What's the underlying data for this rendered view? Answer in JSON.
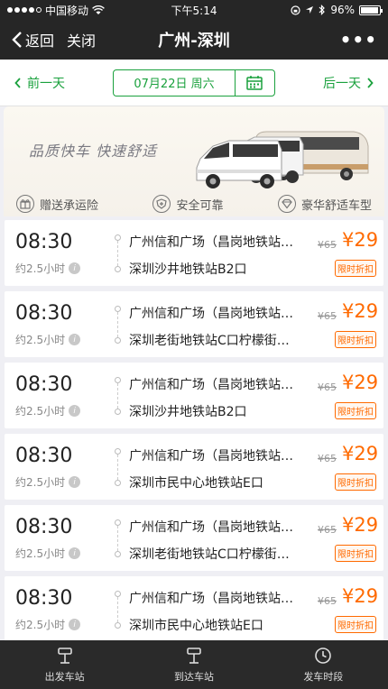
{
  "status_bar": {
    "carrier": "中国移动",
    "time": "下午5:14",
    "battery": "96%",
    "battery_level": 0.96
  },
  "nav": {
    "back_label": "返回",
    "close_label": "关闭",
    "title": "广州-深圳",
    "more_label": "•••"
  },
  "date_bar": {
    "prev_label": "前一天",
    "date": "07月22日 周六",
    "next_label": "后一天"
  },
  "banner": {
    "slogan": "品质快车   快速舒适",
    "features": [
      {
        "icon": "gift-icon",
        "label": "赠送承运险"
      },
      {
        "icon": "shield-icon",
        "label": "安全可靠"
      },
      {
        "icon": "diamond-icon",
        "label": "豪华舒适车型"
      }
    ]
  },
  "trips": [
    {
      "time": "08:30",
      "duration": "约2.5小时",
      "from": "广州信和广场（昌岗地铁站…",
      "to": "深圳沙井地铁站B2口",
      "original_price": "¥65",
      "price": "¥29",
      "tag": "限时折扣"
    },
    {
      "time": "08:30",
      "duration": "约2.5小时",
      "from": "广州信和广场（昌岗地铁站…",
      "to": "深圳老街地铁站C口柠檬街…",
      "original_price": "¥65",
      "price": "¥29",
      "tag": "限时折扣"
    },
    {
      "time": "08:30",
      "duration": "约2.5小时",
      "from": "广州信和广场（昌岗地铁站…",
      "to": "深圳沙井地铁站B2口",
      "original_price": "¥65",
      "price": "¥29",
      "tag": "限时折扣"
    },
    {
      "time": "08:30",
      "duration": "约2.5小时",
      "from": "广州信和广场（昌岗地铁站…",
      "to": "深圳市民中心地铁站E口",
      "original_price": "¥65",
      "price": "¥29",
      "tag": "限时折扣"
    },
    {
      "time": "08:30",
      "duration": "约2.5小时",
      "from": "广州信和广场（昌岗地铁站…",
      "to": "深圳老街地铁站C口柠檬街…",
      "original_price": "¥65",
      "price": "¥29",
      "tag": "限时折扣"
    },
    {
      "time": "08:30",
      "duration": "约2.5小时",
      "from": "广州信和广场（昌岗地铁站…",
      "to": "深圳市民中心地铁站E口",
      "original_price": "¥65",
      "price": "¥29",
      "tag": "限时折扣"
    }
  ],
  "tab_bar": {
    "tabs": [
      {
        "icon": "departure-station-icon",
        "label": "出发车站"
      },
      {
        "icon": "arrival-station-icon",
        "label": "到达车站"
      },
      {
        "icon": "clock-icon",
        "label": "发车时段"
      }
    ]
  },
  "colors": {
    "accent_green": "#1aa13d",
    "price_orange": "#ff6a00",
    "dark_bar": "#262626"
  }
}
